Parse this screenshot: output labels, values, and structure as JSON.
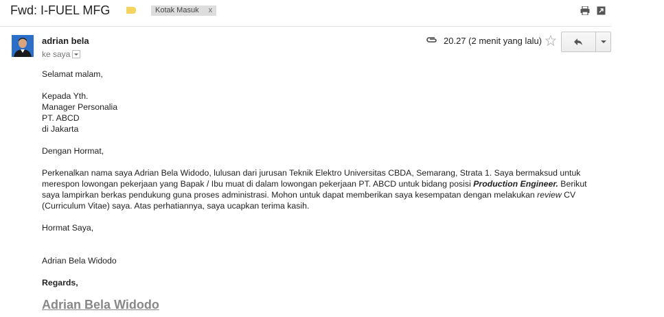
{
  "header": {
    "subject": "Fwd: I-FUEL MFG",
    "label": "Kotak Masuk",
    "label_close": "x",
    "label_color": "#f4d35e"
  },
  "message": {
    "sender": "adrian bela",
    "recipient": "ke saya",
    "time": "20.27 (2 menit yang lalu)"
  },
  "email_body": {
    "greeting": "Selamat malam,",
    "address": [
      "Kepada Yth.",
      "Manager Personalia",
      "PT. ABCD",
      "di Jakarta"
    ],
    "opening": "Dengan Hormat,",
    "para_1": "Perkenalkan nama saya Adrian Bela Widodo, lulusan dari jurusan Teknik Elektro Universitas CBDA, Semarang, Strata 1. Saya bermaksud untuk merespon lowongan pekerjaan yang Bapak / Ibu muat di dalam lowongan pekerjaan PT. ABCD untuk bidang posisi ",
    "position_title": "Production Engineer.",
    "para_2": " Berikut saya lampirkan berkas pendukung guna proses administrasi. Mohon untuk dapat memberikan saya kesempatan dengan melakukan ",
    "review_word": "review",
    "para_3": " CV (Curriculum Vitae) saya. Atas perhatiannya, saya ucapkan terima kasih.",
    "closing": "Hormat Saya,",
    "name": "Adrian Bela Widodo",
    "regards": "Regards,",
    "signature": "Adrian Bela Widodo"
  }
}
